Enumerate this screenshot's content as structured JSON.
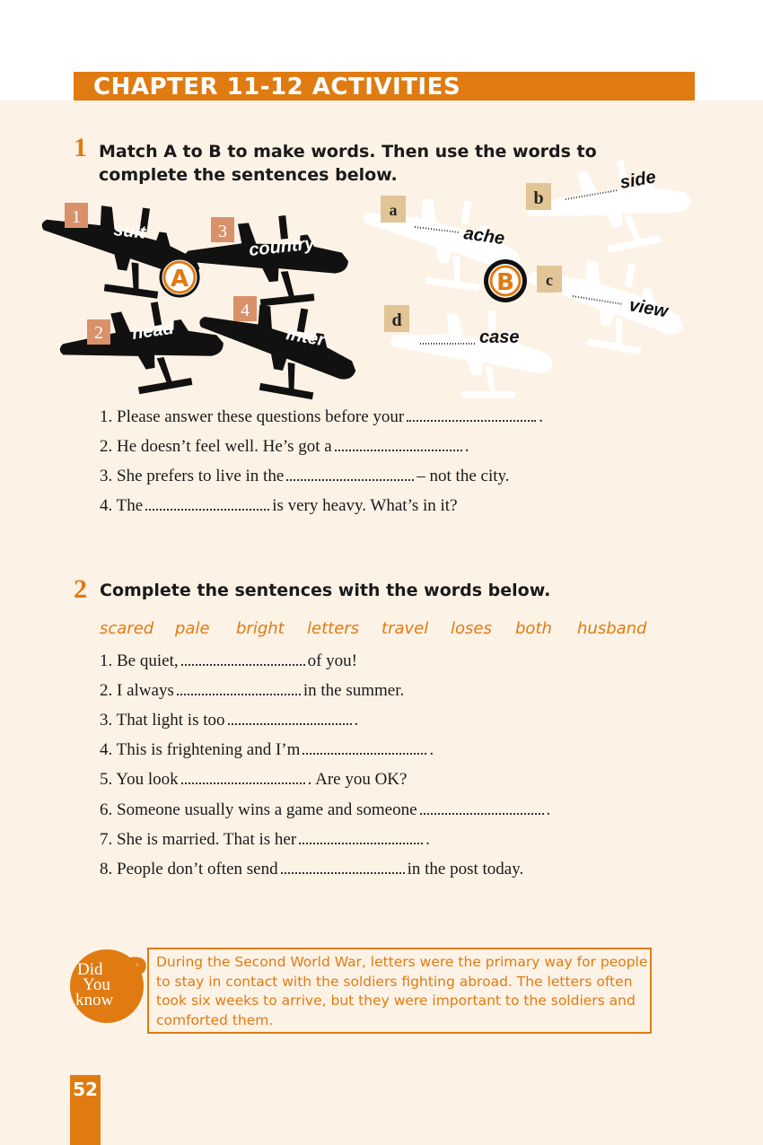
{
  "chapter_title": "CHAPTER 11-12 ACTIVITIES",
  "exercise1": {
    "number": "1",
    "instruction_line1": "Match A to B to make words. Then use the words to",
    "instruction_line2": "complete the sentences below.",
    "group_a_label": "A",
    "group_b_label": "B",
    "group_a": [
      {
        "num": "1",
        "word": "suit"
      },
      {
        "num": "2",
        "word": "head"
      },
      {
        "num": "3",
        "word": "country"
      },
      {
        "num": "4",
        "word": "inter"
      }
    ],
    "group_b": [
      {
        "letter": "a",
        "word": "ache"
      },
      {
        "letter": "b",
        "word": "side"
      },
      {
        "letter": "c",
        "word": "view"
      },
      {
        "letter": "d",
        "word": "case"
      }
    ],
    "sentences": [
      {
        "before": "1. Please answer these questions before your",
        "after": "."
      },
      {
        "before": "2. He doesn’t feel well. He’s got a",
        "after": "."
      },
      {
        "before": "3. She prefers to live in the",
        "after": "– not the city."
      },
      {
        "before": "4. The",
        "after": "is very heavy. What’s in it?"
      }
    ]
  },
  "exercise2": {
    "number": "2",
    "instruction": "Complete the sentences with the words below.",
    "word_bank": [
      "scared",
      "pale",
      "bright",
      "letters",
      "travel",
      "loses",
      "both",
      "husband"
    ],
    "sentences": [
      {
        "before": "1. Be quiet,",
        "after": "of you!"
      },
      {
        "before": "2. I always",
        "after": "in the summer."
      },
      {
        "before": "3. That light is too",
        "after": "."
      },
      {
        "before": "4. This is frightening and I’m",
        "after": "."
      },
      {
        "before": "5. You look",
        "after": ". Are you OK?"
      },
      {
        "before": "6. Someone usually wins a game and someone",
        "after": "."
      },
      {
        "before": "7. She is married. That is her",
        "after": "."
      },
      {
        "before": "8. People don’t often send",
        "after": "in the post today."
      }
    ]
  },
  "did_you_know": {
    "badge_did": "Did",
    "badge_you": "You",
    "badge_know": "know",
    "badge_mark": "?",
    "text": "During the Second World War, letters were the primary way for people to stay in contact with the soldiers fighting abroad. The letters often took six weeks to arrive, but they were important to the soldiers and comforted them."
  },
  "page_number": "52",
  "colors": {
    "accent": "#e07b12",
    "number_box": "#d9916a",
    "letter_box": "#e2c596",
    "plane_dark": "#111111",
    "plane_light": "#ffffff",
    "background": "#fdf2e6"
  }
}
